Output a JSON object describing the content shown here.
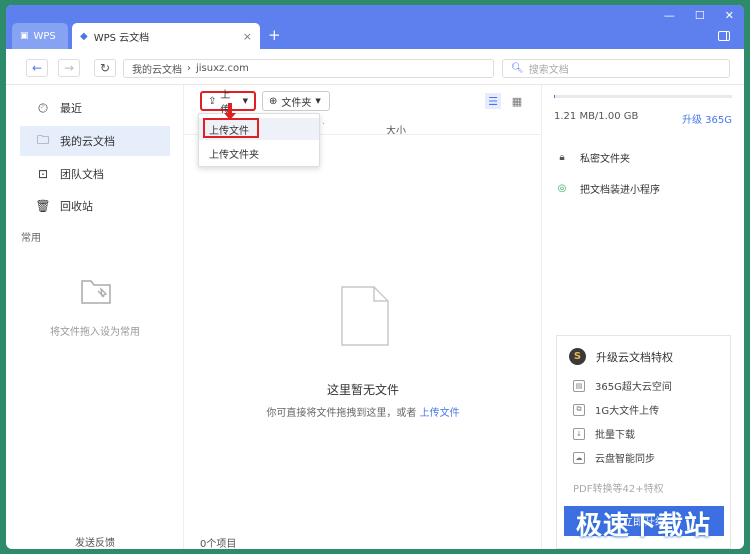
{
  "tabs": {
    "wps": "WPS",
    "doc": "WPS 云文档",
    "close": "×",
    "new": "+"
  },
  "window_controls": {
    "minimize": "—",
    "maximize": "☐",
    "close": "✕"
  },
  "address": {
    "back": "←",
    "forward": "→",
    "refresh": "↻",
    "path_root": "我的云文档",
    "path_sep": "›",
    "path_site": "jisuxz.com",
    "search_placeholder": "搜索文档"
  },
  "nav": {
    "recent": "最近",
    "my_docs": "我的云文档",
    "team_docs": "团队文档",
    "trash": "回收站",
    "common": "常用",
    "fav_placeholder": "将文件拖入设为常用",
    "feedback": "发送反馈"
  },
  "toolbar": {
    "upload": "上传",
    "folder": "文件夹",
    "size_col": "大小"
  },
  "dropdown": {
    "upload_file": "上传文件",
    "upload_folder": "上传文件夹"
  },
  "empty": {
    "title": "这里暂无文件",
    "hint_prefix": "你可直接将文件拖拽到这里，或者",
    "hint_link": "上传文件"
  },
  "footer": {
    "count": "0个项目"
  },
  "right": {
    "quota": "1.21 MB/1.00 GB",
    "quota_fraction": 0.0012,
    "upgrade": "升级 365G",
    "private_folder": "私密文件夹",
    "mini_program": "把文档装进小程序"
  },
  "promo": {
    "title": "升级云文档特权",
    "feat1": "365G超大云空间",
    "feat2": "1G大文件上传",
    "feat3": "批量下载",
    "feat4": "云盘智能同步",
    "pdf": "PDF转换等42+特权",
    "button": "立即升级"
  },
  "watermark": "极速下载站",
  "colors": {
    "accent": "#4a77e8",
    "titlebar": "#5d80ee",
    "highlight": "#e02020"
  }
}
